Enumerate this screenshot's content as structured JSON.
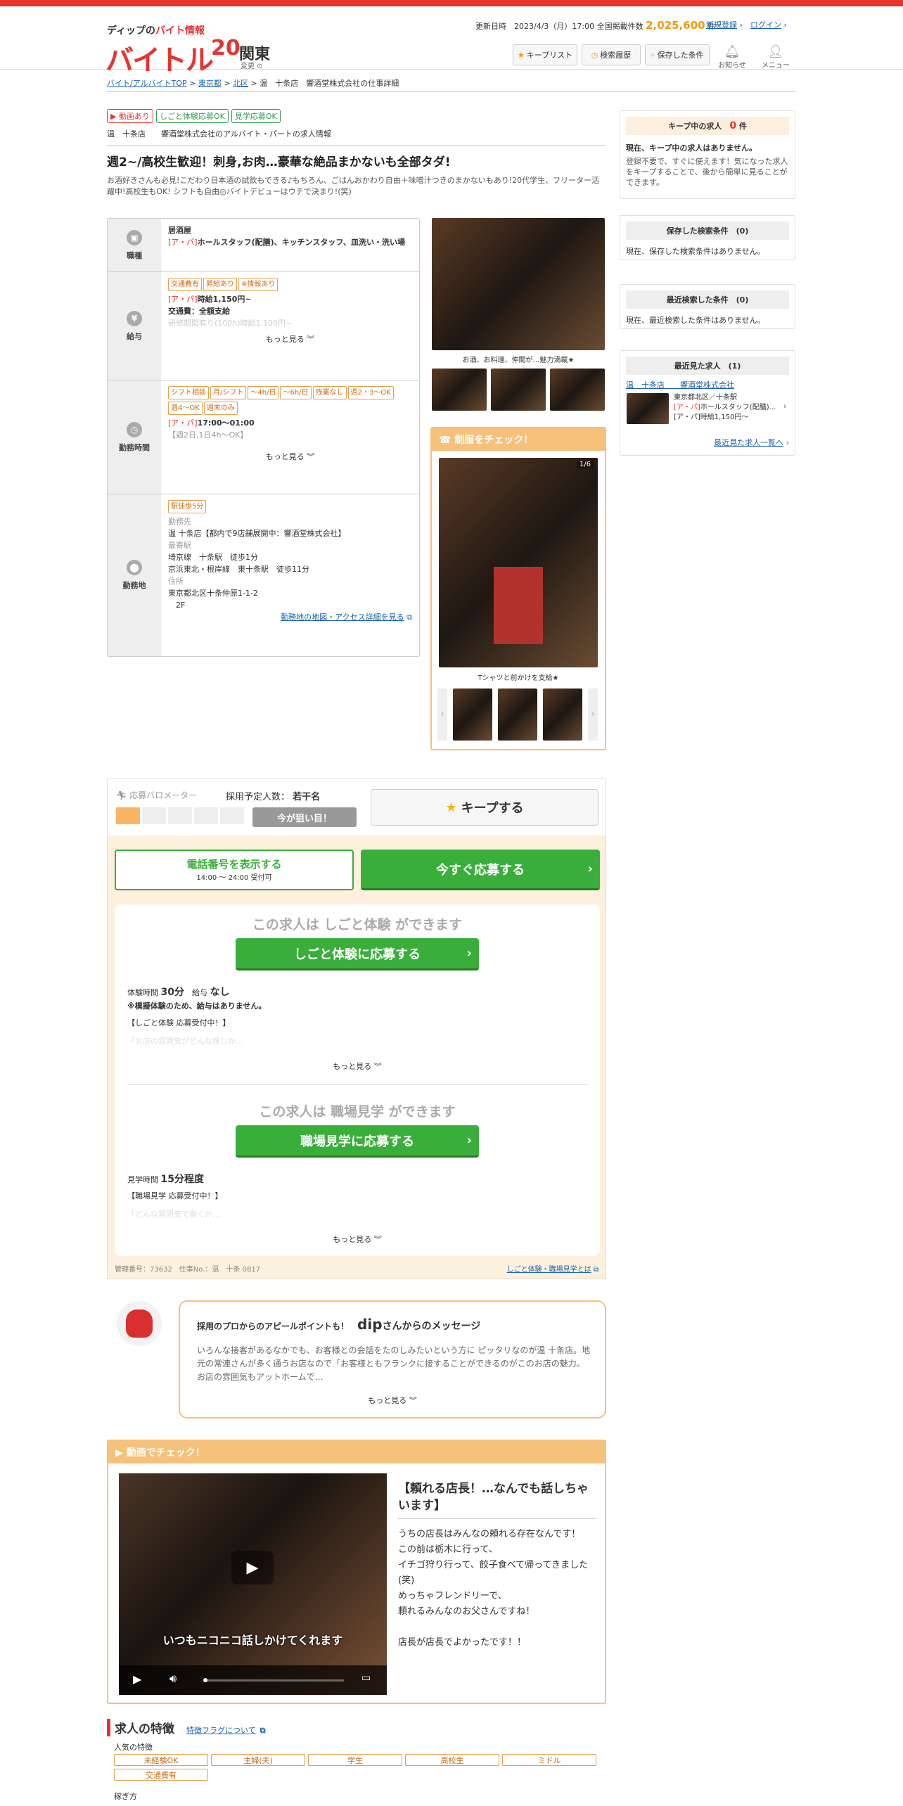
{
  "header": {
    "logo_sub_dip": "ディップの",
    "logo_sub_red": "バイト情報",
    "logo": "バイトル",
    "logo_20": "20",
    "region": "関東",
    "region_change": "変更",
    "updated_label": "更新日時",
    "updated": "2023/4/3（月）17:00",
    "total_label": "全国掲載件数",
    "total_count": "2,025,600",
    "total_unit": "件",
    "signup": "新規登録",
    "login": "ログイン",
    "keep_list": "キープリスト",
    "search_history": "検索履歴",
    "saved_conditions": "保存した条件",
    "notify": "お知らせ",
    "menu": "メニュー"
  },
  "breadcrumb": {
    "b1": "バイト/アルバイトTOP",
    "b2": "東京都",
    "b3": "北区",
    "b4": "温　十条店",
    "b5": "響酒堂株式会社の仕事詳細"
  },
  "badges": {
    "video": "動画あり",
    "trial": "しごと体験応募OK",
    "visit": "見学応募OK"
  },
  "company": {
    "shop": "温　十条店",
    "name": "響酒堂株式会社のアルバイト・パートの求人情報"
  },
  "job": {
    "title": "週2~/高校生歓迎！刺身,お肉…豪華な絶品まかないも全部タダ!",
    "desc": "お酒好きさんも必見!こだわり日本酒の試飲もできる♪もちろん、ごはんおかわり自由＋味噌汁つきのまかないもあり!20代学生、フリーター活躍中!高校生もOK! シフトも自由◎バイトデビューはウチで決まり!(笑)"
  },
  "rows": {
    "shokushu": {
      "label": "職種",
      "type": "居酒屋",
      "ap": "[ア・パ]",
      "job": "ホールスタッフ(配膳)、キッチンスタッフ、皿洗い・洗い場"
    },
    "kyuyo": {
      "label": "給与",
      "tags": [
        "交通費有",
        "昇給あり",
        "※情報あり"
      ],
      "ap": "[ア・パ]",
      "wage": "時給1,150円~",
      "transport": "交通費：全額支給",
      "faded": "研修期間有り(100h)時給1,100円~",
      "more": "もっと見る"
    },
    "kinmu": {
      "label": "勤務時間",
      "tags": [
        "シフト相談",
        "月/シフト",
        "～4h/日",
        "～6h/日",
        "残業なし",
        "週2・3〜OK",
        "週4〜OK",
        "週末のみ"
      ],
      "ap": "[ア・パ]",
      "hours": "17:00～01:00",
      "note": "【週2日,1日4h～OK】",
      "more": "もっと見る"
    },
    "kinmuchi": {
      "label": "勤務地",
      "tag": "駅徒歩5分",
      "place_label": "勤務先",
      "place": "温 十条店【都内で9店舗展開中：響酒堂株式会社】",
      "station_label": "最寄駅",
      "station1": "埼京線　十条駅　徒歩1分",
      "station2": "京浜東北・根岸線　東十条駅　徒歩11分",
      "address_label": "住所",
      "address1": "東京都北区十条仲原1-1-2",
      "address2": "2F",
      "map_link": "勤務地の地図・アクセス詳細を見る"
    }
  },
  "photos": {
    "caption": "お酒、お料理、仲間が…魅力満載★"
  },
  "uniform": {
    "title": "制服をチェック！",
    "counter": "1/6",
    "caption": "Tシャツと前かけを支給★"
  },
  "sidebar": {
    "keep_title": "キープ中の求人",
    "keep_count": "0",
    "keep_unit": "件",
    "keep_none": "現在、キープ中の求人はありません。",
    "keep_desc": "登録不要で、すぐに使えます！気になった求人をキープすることで、後から簡単に見ることができます。",
    "saved_title": "保存した検索条件　(0)",
    "saved_none": "現在、保存した検索条件はありません。",
    "recent_search_title": "最近検索した条件　(0)",
    "recent_search_none": "現在、最近検索した条件はありません。",
    "recent_title": "最近見た求人　(1)",
    "recent_link": "温　十条店　　響酒堂株式会社",
    "recent_place": "東京都北区／十条駅",
    "recent_ap": "[ア・パ]",
    "recent_job": "ホールスタッフ(配膳)...",
    "recent_wage": "[ア・パ]時給1,150円～",
    "recent_more": "最近見た求人一覧へ"
  },
  "apply": {
    "meter_label": "応募バロメーター",
    "plan_label": "採用予定人数：",
    "plan_value": "若干名",
    "now_label": "今が狙い目！",
    "keep_btn": "キープする",
    "phone_btn": "電話番号を表示する",
    "phone_hours": "14:00 ～ 24:00 受付可",
    "apply_btn": "今すぐ応募する",
    "trial_heading": "この求人は しごと体験 ができます",
    "trial_btn": "しごと体験に応募する",
    "trial_time_label": "体験時間",
    "trial_time": "30分",
    "trial_pay_label": "給与",
    "trial_pay": "なし",
    "trial_note": "※模擬体験のため、給与はありません。",
    "trial_recruit": "【しごと体験 応募受付中！】",
    "trial_faded": "「お店の雰囲気がどんな感じか…",
    "more": "もっと見る",
    "visit_heading": "この求人は 職場見学 ができます",
    "visit_btn": "職場見学に応募する",
    "visit_time_label": "見学時間",
    "visit_time": "15分程度",
    "visit_recruit": "【職場見学 応募受付中！】",
    "visit_faded": "「どんな雰囲気で働くか…",
    "mgmt": "管理番号：73632　仕事No.：温　十条 0817",
    "about_link": "しごと体験・職場見学とは"
  },
  "message": {
    "lead": "採用のプロからのアピールポイントも！",
    "dip": "dip",
    "san": "さんからのメッセージ",
    "body": "いろんな接客があるなかでも、お客様との会話をたのしみたいという方に ピッタリなのが温 十条店。地元の常連さんが多く通うお店なので「お客様ともフランクに接することができるのがこのお店の魅力。お店の雰囲気もアットホームで…",
    "more": "もっと見る"
  },
  "video": {
    "title": "動画でチェック！",
    "subtitle": "いつもニコニコ話しかけてくれます",
    "heading": "【頼れる店長！…なんでも話しちゃいます】",
    "body": [
      "うちの店長はみんなの頼れる存在なんです！",
      "この前は栃木に行って、",
      "イチゴ狩り行って、餃子食べて帰ってきました(笑)",
      "めっちゃフレンドリーで、",
      "頼れるみんなのお父さんですね！",
      "",
      "店長が店長でよかったです！！"
    ]
  },
  "features": {
    "title": "求人の特徴",
    "about": "特徴フラグについて",
    "popular_label": "人気の特徴",
    "items": [
      "未経験OK",
      "主婦(夫)",
      "学生",
      "高校生",
      "ミドル",
      "交通費有"
    ],
    "work_style_label": "稼ぎ方"
  }
}
